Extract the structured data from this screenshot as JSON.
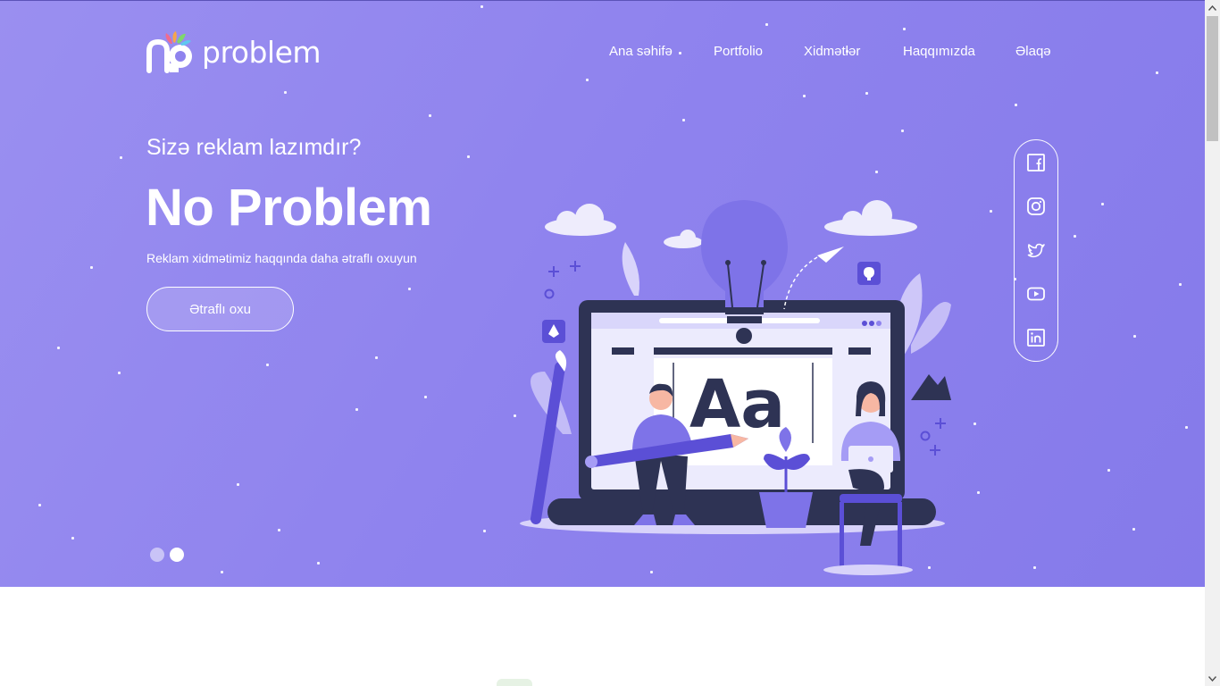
{
  "brand": {
    "logo_text": "problem",
    "colors": {
      "hero_bg": "#8f83ee",
      "accent_dark": "#2e3354",
      "accent_purple": "#5b4fd6",
      "white": "#ffffff"
    }
  },
  "nav": {
    "items": [
      {
        "label": "Ana səhifə"
      },
      {
        "label": "Portfolio"
      },
      {
        "label": "Xidmətlər"
      },
      {
        "label": "Haqqımızda"
      },
      {
        "label": "Əlaqə"
      }
    ]
  },
  "hero": {
    "kicker": "Sizə reklam lazımdır?",
    "headline": "No Problem",
    "subtitle": "Reklam xidmətimiz haqqında daha ətraflı oxuyun",
    "cta_label": "Ətraflı oxu",
    "illustration_text": "Aa"
  },
  "slider": {
    "total": 2,
    "active_index": 2
  },
  "social": {
    "icons": [
      "facebook-icon",
      "instagram-icon",
      "twitter-icon",
      "youtube-icon",
      "linkedin-icon"
    ]
  }
}
